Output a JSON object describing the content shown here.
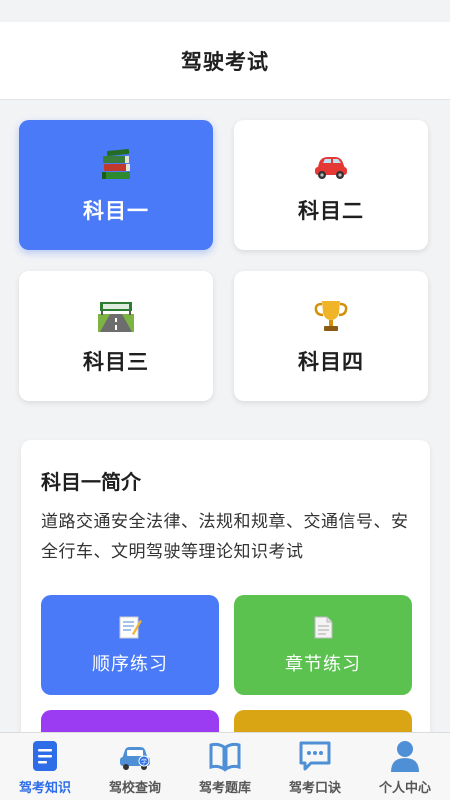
{
  "header": {
    "title": "驾驶考试"
  },
  "subjects": [
    {
      "label": "科目一",
      "icon": "books-icon",
      "active": true
    },
    {
      "label": "科目二",
      "icon": "car-icon",
      "active": false
    },
    {
      "label": "科目三",
      "icon": "road-icon",
      "active": false
    },
    {
      "label": "科目四",
      "icon": "trophy-icon",
      "active": false
    }
  ],
  "intro": {
    "heading": "科目一简介",
    "description": "道路交通安全法律、法规和规章、交通信号、安全行车、文明驾驶等理论知识考试",
    "buttons": [
      {
        "label": "顺序练习",
        "icon": "memo-icon",
        "color": "#4a7af7"
      },
      {
        "label": "章节练习",
        "icon": "document-icon",
        "color": "#5bc24f"
      },
      {
        "label": "",
        "icon": "",
        "color": "#9b3cf3"
      },
      {
        "label": "",
        "icon": "",
        "color": "#d9a514"
      }
    ]
  },
  "tabbar": {
    "items": [
      {
        "label": "驾考知识",
        "icon": "document-list-icon",
        "active": true
      },
      {
        "label": "驾校查询",
        "icon": "car-school-icon",
        "active": false
      },
      {
        "label": "驾考题库",
        "icon": "book-icon",
        "active": false
      },
      {
        "label": "驾考口诀",
        "icon": "chat-icon",
        "active": false
      },
      {
        "label": "个人中心",
        "icon": "person-icon",
        "active": false
      }
    ]
  },
  "colors": {
    "accent": "#4a7af7",
    "tab_active": "#2d6de8",
    "tab_inactive": "#4f8fd6"
  }
}
